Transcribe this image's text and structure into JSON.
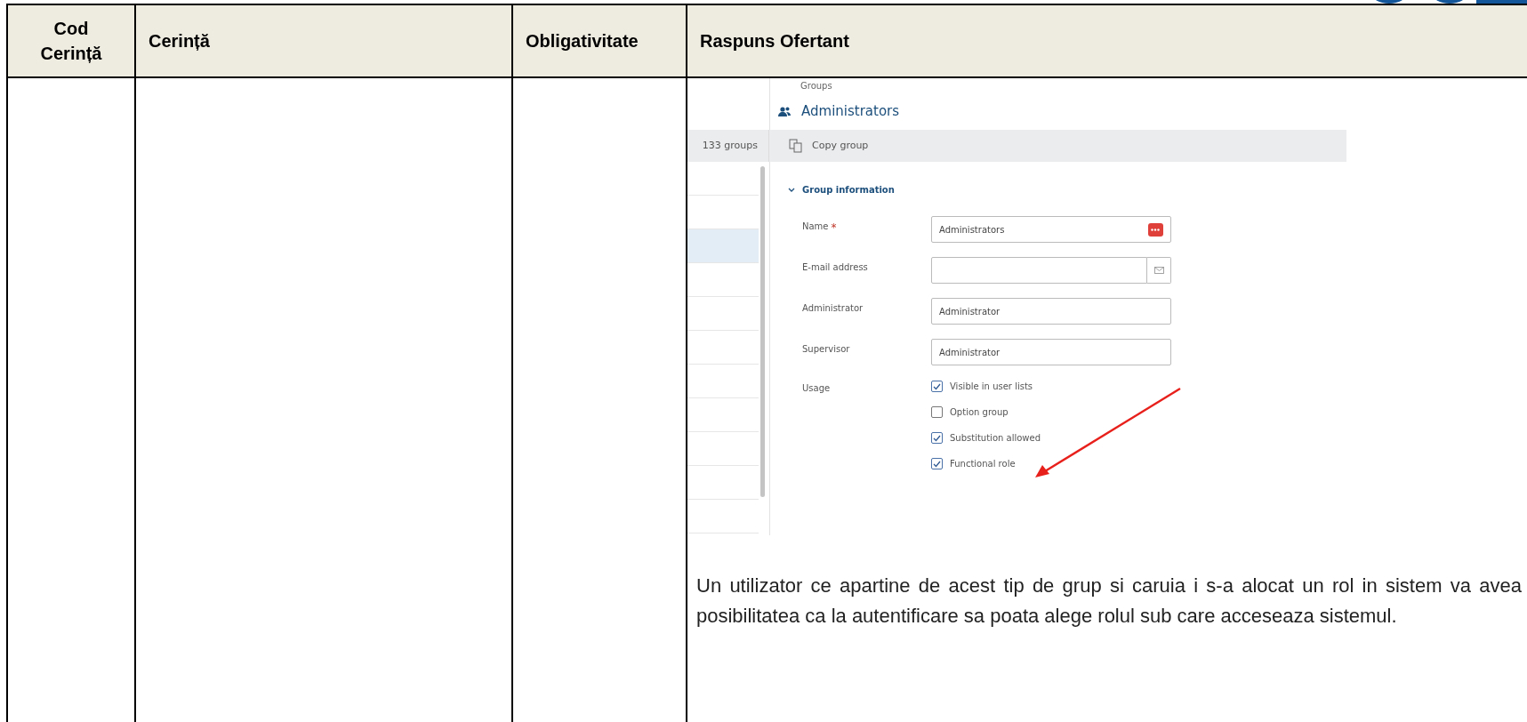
{
  "table": {
    "columns": [
      "Cod Cerință",
      "Cerință",
      "Obligativitate",
      "Raspuns Ofertant"
    ],
    "rows": [
      {
        "response": {
          "screenshot": {
            "breadcrumb": "Groups",
            "title": "Administrators",
            "count": "133 groups",
            "action": "Copy group",
            "list_rows": [
              {
                "selected": false
              },
              {
                "selected": false
              },
              {
                "selected": true
              },
              {
                "selected": false
              },
              {
                "selected": false
              },
              {
                "selected": false
              },
              {
                "selected": false
              },
              {
                "selected": false
              },
              {
                "selected": false
              },
              {
                "selected": false
              },
              {
                "selected": false
              }
            ],
            "section": {
              "title": "Group information",
              "expanded": true
            },
            "fields": [
              {
                "kind": "vault",
                "label": "Name",
                "required_mark": "*",
                "value": "Administrators"
              },
              {
                "kind": "email",
                "label": "E-mail address"
              },
              {
                "kind": "text",
                "label": "Administrator",
                "value": "Administrator"
              },
              {
                "kind": "text",
                "label": "Supervisor",
                "value": "Administrator"
              }
            ],
            "usage": {
              "label": "Usage",
              "options": [
                {
                  "label": "Visible in user lists",
                  "checked": true
                },
                {
                  "label": "Option group",
                  "checked": false
                },
                {
                  "label": "Substitution allowed",
                  "checked": true
                },
                {
                  "label": "Functional role",
                  "checked": true
                }
              ]
            }
          },
          "paragraph": "Un utilizator ce apartine de acest tip de grup si caruia i s-a alocat un rol in sistem va avea posibilitatea ca la autentificare sa poata alege rolul sub care acceseaza sistemul."
        }
      }
    ]
  }
}
